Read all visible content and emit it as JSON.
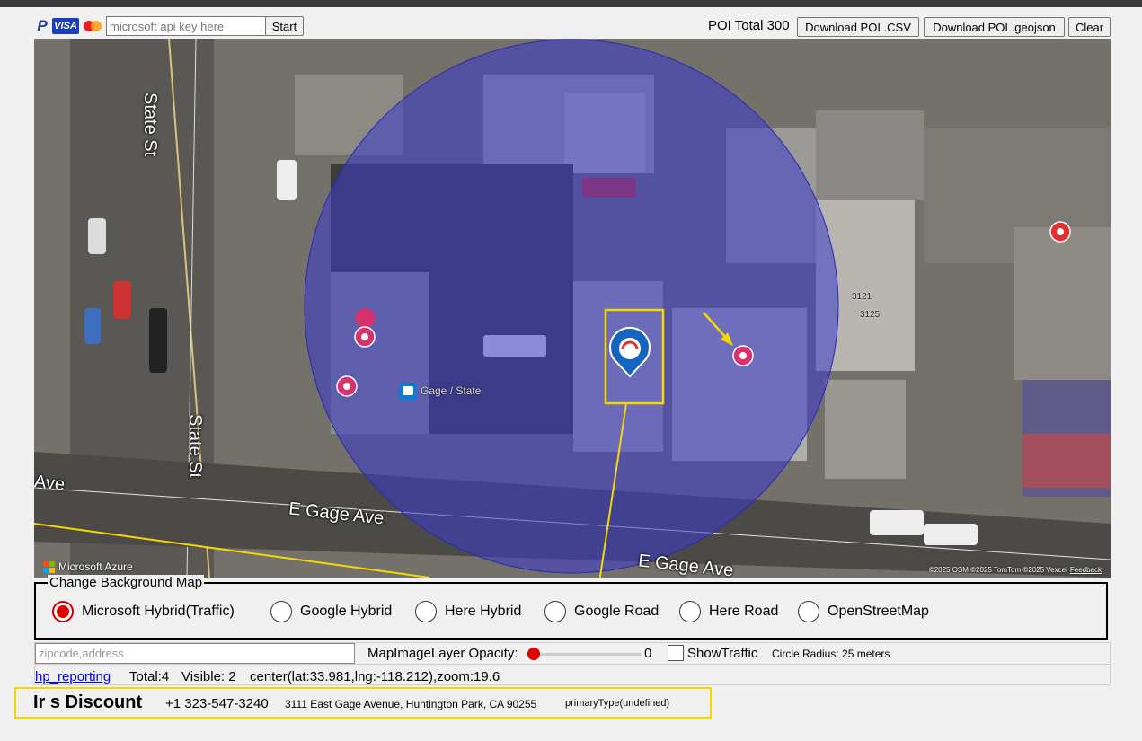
{
  "toolbar": {
    "payment_icons": [
      "paypal-icon",
      "visa-icon",
      "mastercard-icon"
    ],
    "visa_label": "VISA",
    "api_key_placeholder": "microsoft api key here",
    "start_label": "Start",
    "poi_total": "POI Total 300",
    "download_csv_label": "Download POI .CSV",
    "download_geojson_label": "Download POI .geojson",
    "clear_label": "Clear"
  },
  "map": {
    "road_labels": [
      "State St",
      "State St",
      "E Gage Ave",
      "E Gage Ave",
      "Ave"
    ],
    "transit_label": "Gage / State",
    "address_numbers": [
      "3121",
      "3125"
    ],
    "branding": "Microsoft Azure",
    "attribution": "©2025 OSM  ©2025 TomTom  ©2025 Vexcel",
    "feedback_label": "Feedback",
    "circle_color": "#3a3acc",
    "marker_color": "#d6336c",
    "selected_marker_color": "#1565c0",
    "highlight_color": "#f5d800"
  },
  "background_map": {
    "legend": "Change Background Map",
    "options": [
      {
        "label": "Microsoft Hybrid(Traffic)",
        "selected": true
      },
      {
        "label": "Google Hybrid",
        "selected": false
      },
      {
        "label": "Here Hybrid",
        "selected": false
      },
      {
        "label": "Google Road",
        "selected": false
      },
      {
        "label": "Here Road",
        "selected": false
      },
      {
        "label": "OpenStreetMap",
        "selected": false
      }
    ]
  },
  "controls": {
    "zip_placeholder": "zipcode,address",
    "opacity_label": "MapImageLayer Opacity:",
    "opacity_value": "0",
    "show_traffic_label": "ShowTraffic",
    "circle_radius": "Circle Radius: 25 meters"
  },
  "status": {
    "link": "hp_reporting",
    "total": "Total:4",
    "visible": "Visible: 2",
    "center": "center(lat:33.981,lng:-118.212),zoom:19.6"
  },
  "selected_poi": {
    "name": "Ir s Discount",
    "phone": "+1 323-547-3240",
    "address": "3111 East Gage Avenue, Huntington Park, CA 90255",
    "primary_type": "primaryType(undefined)"
  }
}
